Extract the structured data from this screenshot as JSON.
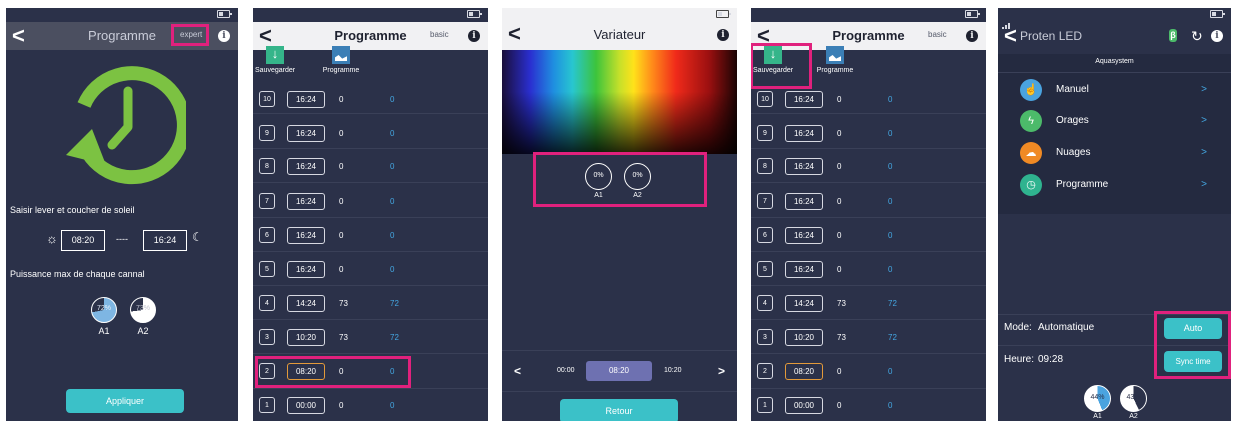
{
  "screen1": {
    "title": "Programme",
    "mode_button": "expert",
    "info_icon": "i",
    "back_icon": "<",
    "sunrise_label": "Saisir lever et coucher de soleil",
    "sunrise_time": "08:20",
    "dash": "----",
    "sunset_time": "16:24",
    "power_label": "Puissance max de chaque cannal",
    "channels": [
      {
        "label": "A1",
        "value": 72,
        "pie_text": "72%"
      },
      {
        "label": "A2",
        "value": 73,
        "pie_text": "73%"
      }
    ],
    "apply_button": "Appliquer",
    "accent_color": "#7cc242"
  },
  "screen2": {
    "title": "Programme",
    "mode_button": "basic",
    "toolbar": {
      "save_label": "Sauvegarder",
      "program_label": "Programme"
    },
    "rows": [
      {
        "num": "10",
        "time": "16:24",
        "a1": "0",
        "a2": "0"
      },
      {
        "num": "9",
        "time": "16:24",
        "a1": "0",
        "a2": "0"
      },
      {
        "num": "8",
        "time": "16:24",
        "a1": "0",
        "a2": "0"
      },
      {
        "num": "7",
        "time": "16:24",
        "a1": "0",
        "a2": "0"
      },
      {
        "num": "6",
        "time": "16:24",
        "a1": "0",
        "a2": "0"
      },
      {
        "num": "5",
        "time": "16:24",
        "a1": "0",
        "a2": "0"
      },
      {
        "num": "4",
        "time": "14:24",
        "a1": "73",
        "a2": "72"
      },
      {
        "num": "3",
        "time": "10:20",
        "a1": "73",
        "a2": "72"
      },
      {
        "num": "2",
        "time": "08:20",
        "a1": "0",
        "a2": "0"
      },
      {
        "num": "1",
        "time": "00:00",
        "a1": "0",
        "a2": "0"
      }
    ]
  },
  "screen3": {
    "title": "Variateur",
    "channels": [
      {
        "label": "A1",
        "pie_text": "0%"
      },
      {
        "label": "A2",
        "pie_text": "0%"
      }
    ],
    "timeline": {
      "prev": "<",
      "left_time": "00:00",
      "current_time": "08:20",
      "right_time": "10:20",
      "next": ">"
    },
    "return_button": "Retour"
  },
  "screen4": {
    "title": "Programme",
    "mode_button": "basic",
    "toolbar": {
      "save_label": "Sauvegarder",
      "program_label": "Programme"
    },
    "rows": [
      {
        "num": "10",
        "time": "16:24",
        "a1": "0",
        "a2": "0"
      },
      {
        "num": "9",
        "time": "16:24",
        "a1": "0",
        "a2": "0"
      },
      {
        "num": "8",
        "time": "16:24",
        "a1": "0",
        "a2": "0"
      },
      {
        "num": "7",
        "time": "16:24",
        "a1": "0",
        "a2": "0"
      },
      {
        "num": "6",
        "time": "16:24",
        "a1": "0",
        "a2": "0"
      },
      {
        "num": "5",
        "time": "16:24",
        "a1": "0",
        "a2": "0"
      },
      {
        "num": "4",
        "time": "14:24",
        "a1": "73",
        "a2": "72"
      },
      {
        "num": "3",
        "time": "10:20",
        "a1": "73",
        "a2": "72"
      },
      {
        "num": "2",
        "time": "08:20",
        "a1": "0",
        "a2": "0"
      },
      {
        "num": "1",
        "time": "00:00",
        "a1": "0",
        "a2": "0"
      }
    ]
  },
  "screen5": {
    "title": "Proten LED",
    "subtitle": "Aquasystem",
    "menu": [
      {
        "label": "Manuel",
        "icon": "hand-icon",
        "color": "#4aa3df",
        "glyph": "☝"
      },
      {
        "label": "Orages",
        "icon": "lightning-icon",
        "color": "#4cba6a",
        "glyph": "ϟ"
      },
      {
        "label": "Nuages",
        "icon": "cloud-icon",
        "color": "#f08a24",
        "glyph": "☁"
      },
      {
        "label": "Programme",
        "icon": "clock-icon",
        "color": "#2fb38f",
        "glyph": "◷"
      }
    ],
    "mode_label": "Mode:",
    "mode_value": "Automatique",
    "hour_label": "Heure:",
    "hour_value": "09:28",
    "auto_button": "Auto",
    "sync_button": "Sync time",
    "channels": [
      {
        "label": "A1",
        "value": 44,
        "pie_text": "44%"
      },
      {
        "label": "A2",
        "value": 43,
        "pie_text": "43%"
      }
    ]
  },
  "colors": {
    "highlight": "#e0217d",
    "background": "#2b3149",
    "teal": "#3bc1c8",
    "blue_value": "#44a7e2"
  }
}
